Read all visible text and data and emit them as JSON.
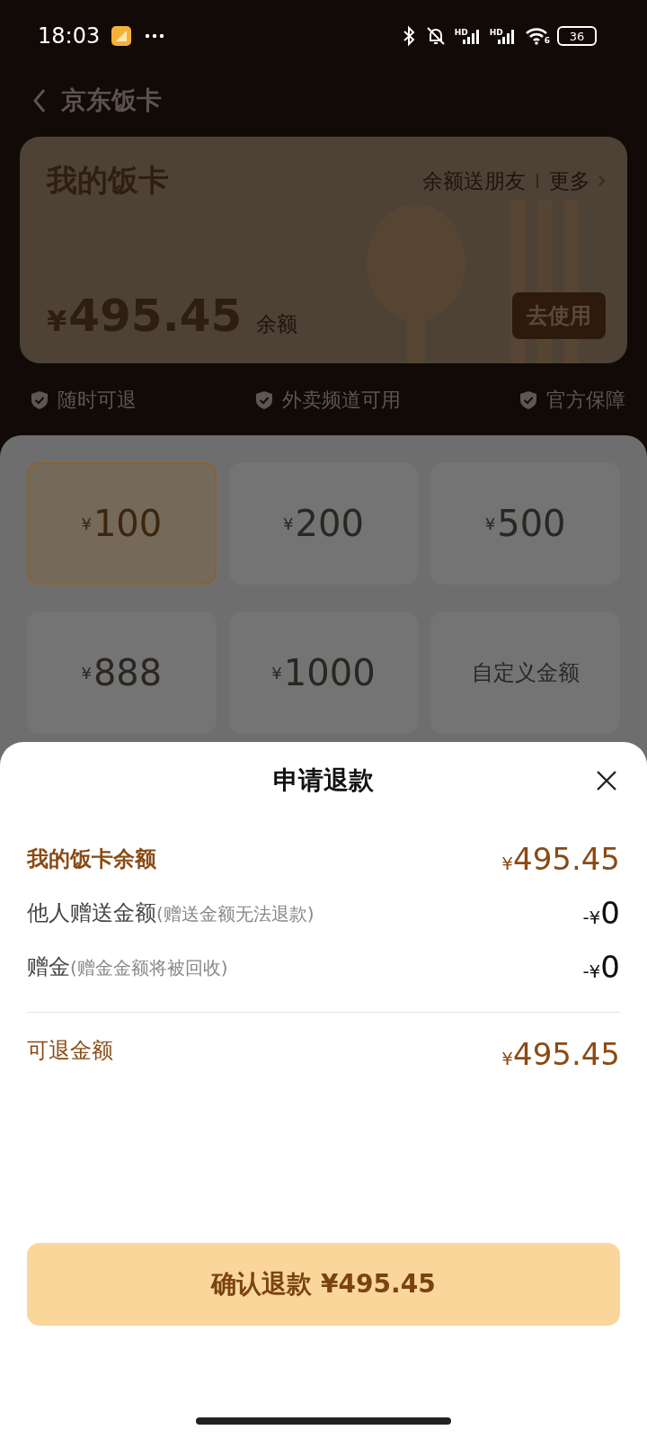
{
  "status_bar": {
    "time": "18:03",
    "signal_labels": [
      "HD",
      "HD"
    ],
    "wifi_label": "6",
    "battery": "36"
  },
  "header": {
    "title": "京东饭卡"
  },
  "card": {
    "title": "我的饭卡",
    "links": [
      "余额送朋友",
      "更多"
    ],
    "currency": "¥",
    "balance": "495.45",
    "balance_label": "余额",
    "use_button": "去使用"
  },
  "guarantees": [
    "随时可退",
    "外卖频道可用",
    "官方保障"
  ],
  "amounts": [
    {
      "kind": "preset",
      "currency": "¥",
      "amount": "100",
      "selected": true
    },
    {
      "kind": "preset",
      "currency": "¥",
      "amount": "200",
      "selected": false
    },
    {
      "kind": "preset",
      "currency": "¥",
      "amount": "500",
      "selected": false
    },
    {
      "kind": "preset",
      "currency": "¥",
      "amount": "888",
      "selected": false
    },
    {
      "kind": "preset",
      "currency": "¥",
      "amount": "1000",
      "selected": false
    },
    {
      "kind": "custom",
      "label": "自定义金额",
      "selected": false
    }
  ],
  "sheet": {
    "title": "申请退款",
    "rows": [
      {
        "kind": "highlight",
        "label": "我的饭卡余额",
        "sign": "¥",
        "amount": "495.45"
      },
      {
        "kind": "deduction",
        "label": "他人赠送金额",
        "note": "(赠送金额无法退款)",
        "sign": "-¥",
        "amount": "0"
      },
      {
        "kind": "deduction",
        "label": "赠金",
        "note": "(赠金金额将被回收)",
        "sign": "-¥",
        "amount": "0"
      }
    ],
    "total": {
      "label": "可退金额",
      "sign": "¥",
      "amount": "495.45"
    },
    "confirm_button": "确认退款 ¥495.45"
  }
}
